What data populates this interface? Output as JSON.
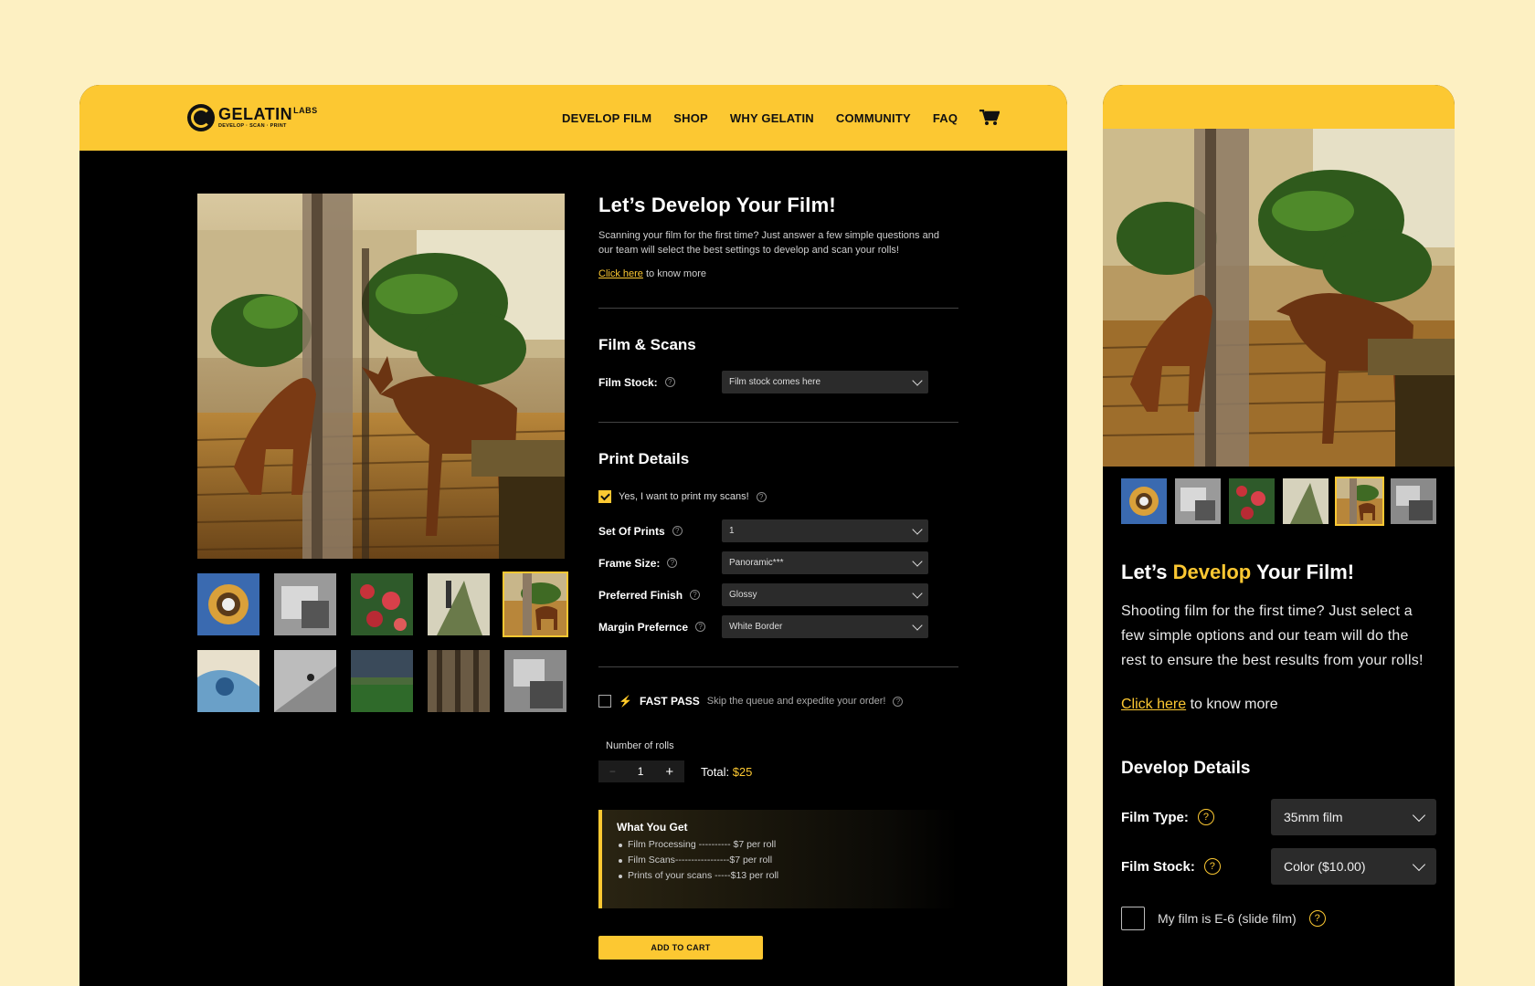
{
  "brand": {
    "name": "GELATIN",
    "suffix": "LABS",
    "tagline": "DEVELOP · SCAN · PRINT"
  },
  "nav": {
    "items": [
      "DEVELOP FILM",
      "SHOP",
      "WHY GELATIN",
      "COMMUNITY",
      "FAQ"
    ],
    "cart_icon": "cart-icon"
  },
  "desktop": {
    "title": "Let’s Develop Your Film!",
    "intro": "Scanning your film for the first time? Just answer a few simple questions and our team will select the best settings to develop and scan your rolls!",
    "know_link": "Click here",
    "know_rest": " to know more",
    "film_scans": {
      "heading": "Film & Scans",
      "film_stock_label": "Film Stock:",
      "film_stock_value": "Film stock comes here"
    },
    "print_details": {
      "heading": "Print Details",
      "print_check_label": "Yes, I want to print my scans!",
      "print_checked": true,
      "rows": [
        {
          "label": "Set Of Prints",
          "value": "1"
        },
        {
          "label": "Frame Size:",
          "value": "Panoramic***"
        },
        {
          "label": "Preferred Finish",
          "value": "Glossy"
        },
        {
          "label": "Margin Prefernce",
          "value": "White Border"
        }
      ]
    },
    "fast_pass": {
      "label": "FAST PASS",
      "desc": "Skip the queue and expedite your order!",
      "checked": false
    },
    "rolls": {
      "label": "Number of rolls",
      "minus": "−",
      "value": "1",
      "plus": "+",
      "total_label": "Total: ",
      "total_value": "$25"
    },
    "what_you_get": {
      "title": "What You Get",
      "items": [
        "Film Processing ---------- $7 per roll",
        "Film Scans-----------------$7 per roll",
        "Prints of your scans -----$13 per roll"
      ]
    },
    "add_to_cart": "ADD TO CART",
    "thumbnail_count": 10,
    "active_thumbnail_index": 4
  },
  "mobile": {
    "title_pre": "Let’s ",
    "title_hl": "Develop",
    "title_post": " Your Film!",
    "intro": "Shooting film for the first time? Just select a few simple options and our team will do the rest to ensure the best results from your rolls!",
    "know_link": "Click here",
    "know_rest": " to know more",
    "develop": {
      "heading": "Develop Details",
      "film_type_label": "Film Type:",
      "film_type_value": "35mm film",
      "film_stock_label": "Film Stock:",
      "film_stock_value": "Color ($10.00)",
      "slide_label": "My film is E-6 (slide film)",
      "slide_checked": false
    },
    "active_thumbnail_index": 4
  },
  "colors": {
    "accent": "#fcc832",
    "page_bg": "#fdf0c2",
    "panel_bg": "#000000"
  }
}
